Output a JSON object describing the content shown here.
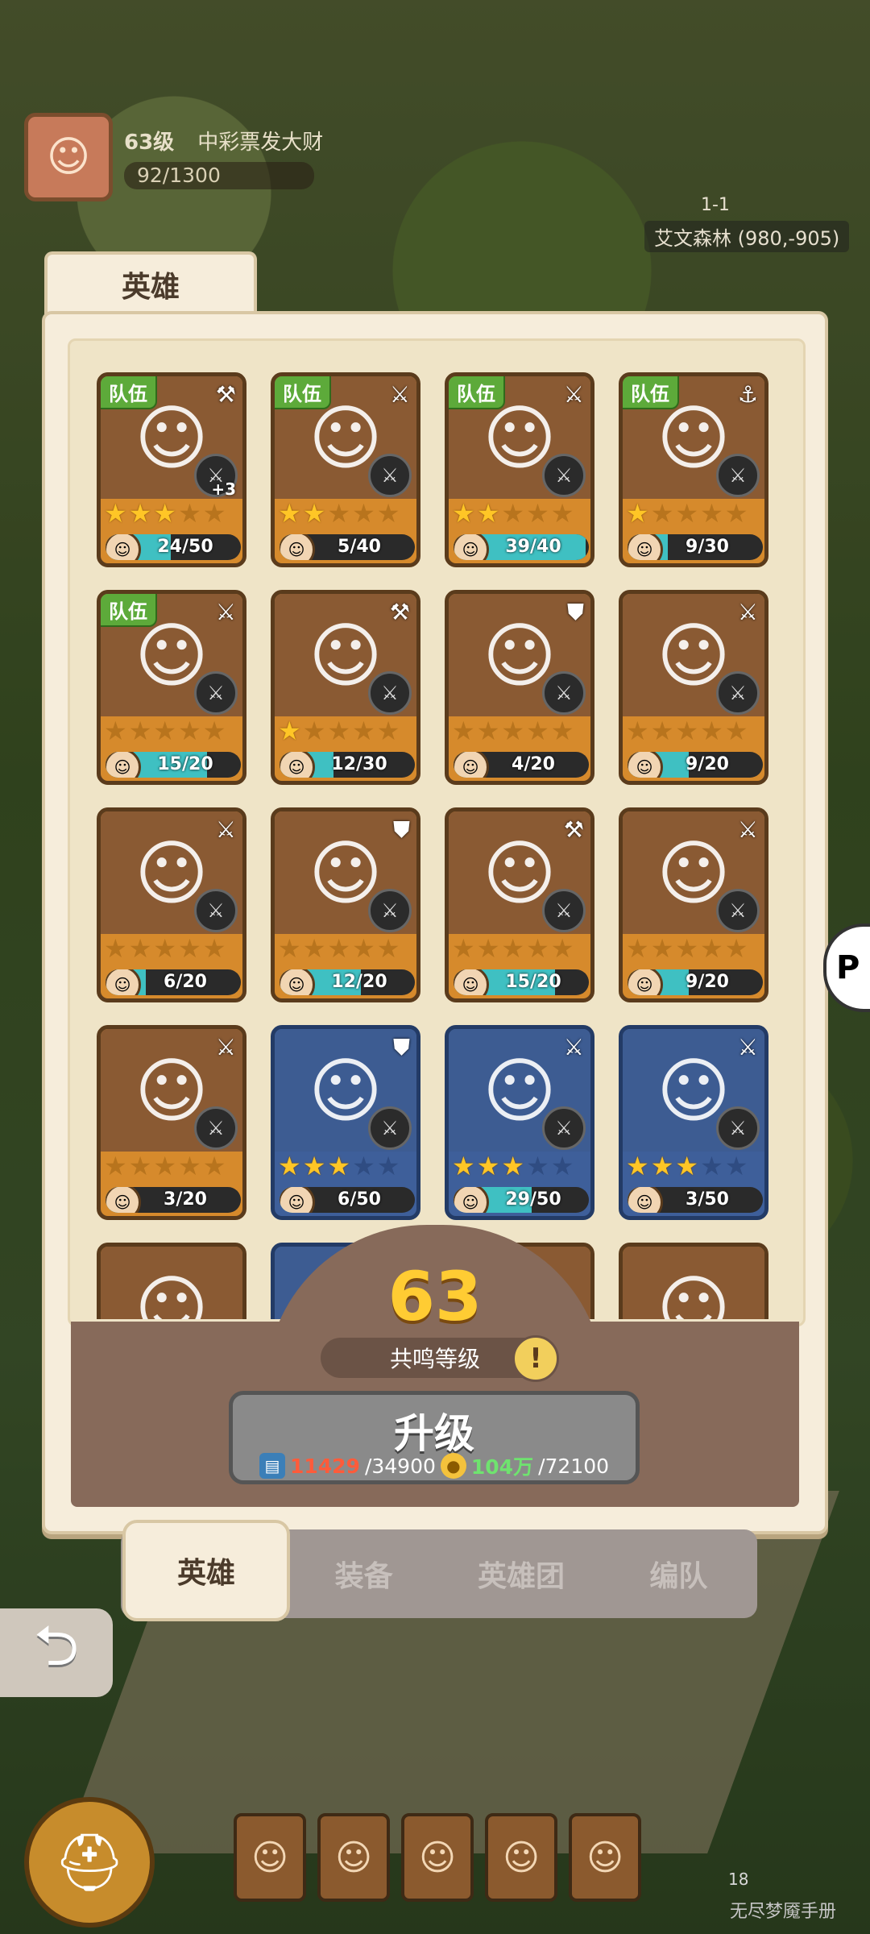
{
  "profile": {
    "level": "63级",
    "name": "中彩票发大财",
    "exp": "92/1300"
  },
  "map": {
    "stage": "1-1",
    "location": "艾文森林 (980,-905)"
  },
  "panel": {
    "title": "英雄"
  },
  "team_badge": "队伍",
  "heroes": [
    {
      "team": true,
      "stars": 3,
      "max_stars": 5,
      "shards": "24/50",
      "progress": 0.48,
      "rarity": "orange",
      "bonus": "+3"
    },
    {
      "team": true,
      "stars": 2,
      "max_stars": 5,
      "shards": "5/40",
      "progress": 0.125,
      "rarity": "orange",
      "bonus": ""
    },
    {
      "team": true,
      "stars": 2,
      "max_stars": 5,
      "shards": "39/40",
      "progress": 0.975,
      "rarity": "orange",
      "bonus": ""
    },
    {
      "team": true,
      "stars": 1,
      "max_stars": 5,
      "shards": "9/30",
      "progress": 0.3,
      "rarity": "orange",
      "bonus": ""
    },
    {
      "team": true,
      "stars": 0,
      "max_stars": 5,
      "shards": "15/20",
      "progress": 0.75,
      "rarity": "orange",
      "bonus": ""
    },
    {
      "team": false,
      "stars": 1,
      "max_stars": 5,
      "shards": "12/30",
      "progress": 0.4,
      "rarity": "orange",
      "bonus": ""
    },
    {
      "team": false,
      "stars": 0,
      "max_stars": 5,
      "shards": "4/20",
      "progress": 0.2,
      "rarity": "orange",
      "bonus": ""
    },
    {
      "team": false,
      "stars": 0,
      "max_stars": 5,
      "shards": "9/20",
      "progress": 0.45,
      "rarity": "orange",
      "bonus": ""
    },
    {
      "team": false,
      "stars": 0,
      "max_stars": 5,
      "shards": "6/20",
      "progress": 0.3,
      "rarity": "orange",
      "bonus": ""
    },
    {
      "team": false,
      "stars": 0,
      "max_stars": 5,
      "shards": "12/20",
      "progress": 0.6,
      "rarity": "orange",
      "bonus": ""
    },
    {
      "team": false,
      "stars": 0,
      "max_stars": 5,
      "shards": "15/20",
      "progress": 0.75,
      "rarity": "orange",
      "bonus": ""
    },
    {
      "team": false,
      "stars": 0,
      "max_stars": 5,
      "shards": "9/20",
      "progress": 0.45,
      "rarity": "orange",
      "bonus": ""
    },
    {
      "team": false,
      "stars": 0,
      "max_stars": 5,
      "shards": "3/20",
      "progress": 0.15,
      "rarity": "orange",
      "bonus": ""
    },
    {
      "team": false,
      "stars": 3,
      "max_stars": 5,
      "shards": "6/50",
      "progress": 0.12,
      "rarity": "blue",
      "bonus": ""
    },
    {
      "team": false,
      "stars": 3,
      "max_stars": 5,
      "shards": "29/50",
      "progress": 0.58,
      "rarity": "blue",
      "bonus": ""
    },
    {
      "team": false,
      "stars": 3,
      "max_stars": 5,
      "shards": "3/50",
      "progress": 0.06,
      "rarity": "blue",
      "bonus": ""
    }
  ],
  "resonance": {
    "level": "63",
    "label": "共鸣等级",
    "info_glyph": "!"
  },
  "upgrade": {
    "label": "升级",
    "books_have": "11429",
    "books_need": "/34900",
    "gold_have": "104万",
    "gold_need": "/72100"
  },
  "tabs": [
    "英雄",
    "装备",
    "英雄团",
    "编队"
  ],
  "active_tab": 0,
  "bottom": {
    "count": "18",
    "caption": "无尽梦魇手册"
  },
  "colors": {
    "orange_card": "#d68a2c",
    "blue_card": "#3e5f9a",
    "team_badge": "#5daa3a",
    "resonance_level": "#ffcc33",
    "shard_fill": "#3fc0c2"
  }
}
